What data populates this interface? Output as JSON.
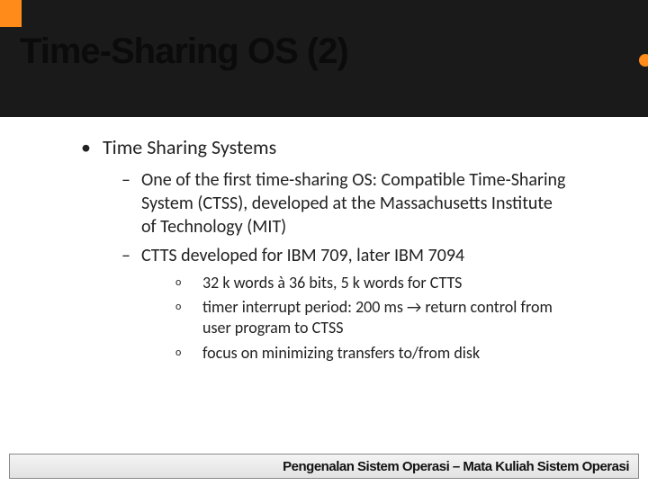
{
  "title": "Time-Sharing OS (2)",
  "bullets": {
    "heading": "Time Sharing Systems",
    "sub1": "One of the first time-sharing OS: Compatible Time-Sharing System (CTSS), developed at the Massachusetts Institute of Technology (MIT)",
    "sub2": "CTTS developed for IBM 709, later IBM 7094",
    "sub2_a": "32 k words à 36 bits, 5 k words for CTTS",
    "sub2_b": "timer interrupt period: 200 ms → return control from user program to CTSS",
    "sub2_c": "focus on minimizing transfers to/from disk"
  },
  "footer": "Pengenalan Sistem Operasi – Mata Kuliah Sistem Operasi"
}
